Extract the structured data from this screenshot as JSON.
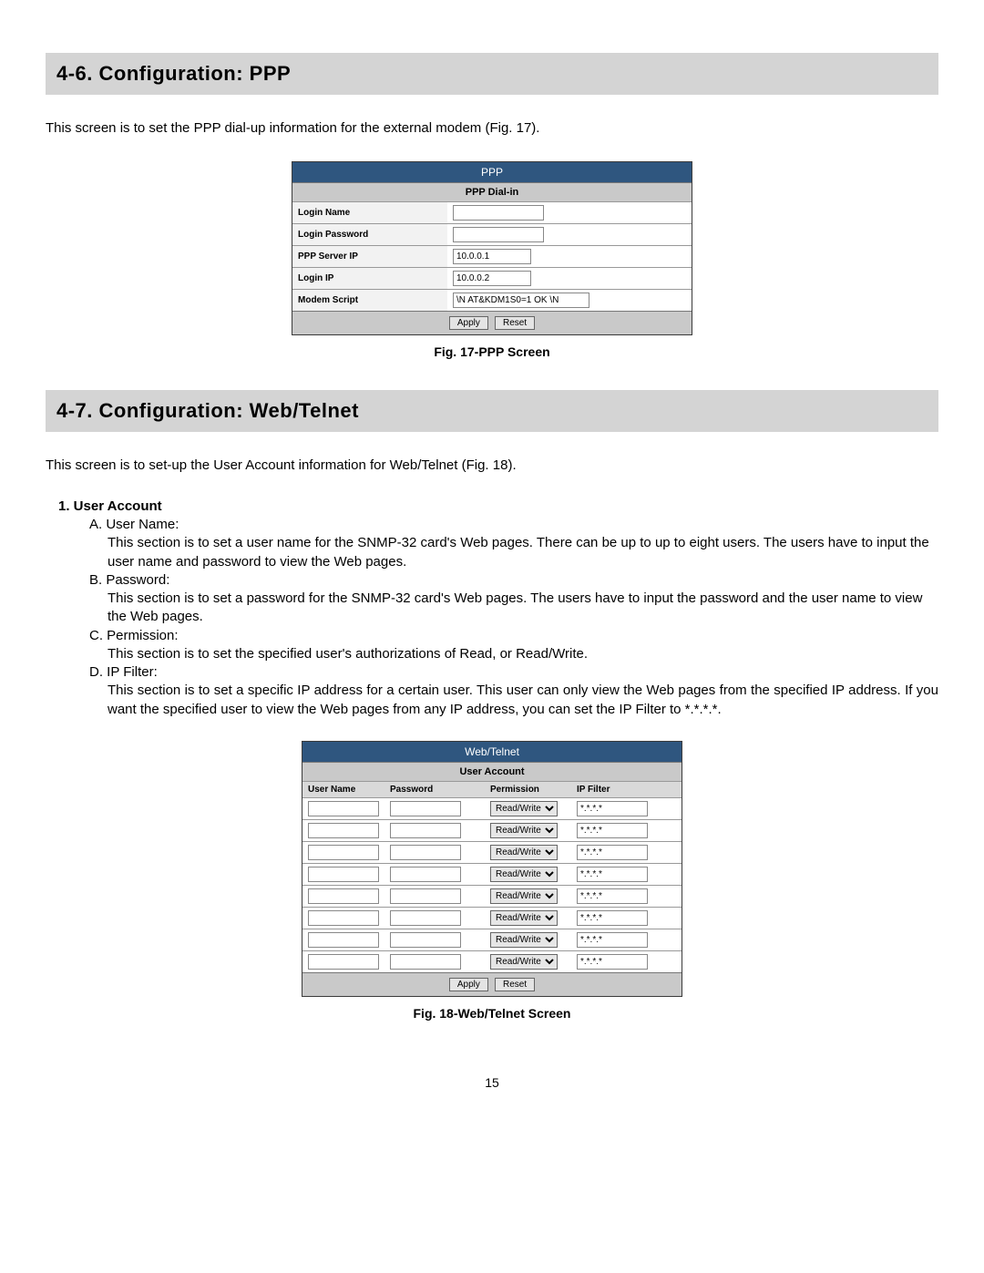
{
  "section1": {
    "heading": "4-6.  Configuration: PPP",
    "intro": "This screen is to set the PPP dial-up information for the external modem (Fig. 17)."
  },
  "ppp": {
    "title": "PPP",
    "subtitle": "PPP Dial-in",
    "row_login_name_label": "Login Name",
    "row_login_name_value": "",
    "row_login_password_label": "Login Password",
    "row_login_password_value": "",
    "row_server_ip_label": "PPP Server IP",
    "row_server_ip_value": "10.0.0.1",
    "row_login_ip_label": "Login IP",
    "row_login_ip_value": "10.0.0.2",
    "row_modem_script_label": "Modem Script",
    "row_modem_script_value": "\\N AT&KDM1S0=1 OK \\N",
    "apply_label": "Apply",
    "reset_label": "Reset",
    "caption": "Fig. 17-PPP Screen"
  },
  "section2": {
    "heading": "4-7.  Configuration: Web/Telnet",
    "intro": "This screen is to set-up the User Account information for Web/Telnet (Fig. 18)."
  },
  "ua": {
    "heading": "1.   User Account",
    "a_label": "A.   User Name:",
    "a_desc": "This section is to set a user name for the SNMP-32 card's Web pages.  There can be up to up to eight users.  The users have to input the user name and password to view the Web pages.",
    "b_label": "B.   Password:",
    "b_desc": "This section is to set a password for the SNMP-32 card's Web pages.  The users have to input the password and the user name to view the Web pages.",
    "c_label": "C.   Permission:",
    "c_desc": "This section is to set the specified user's authorizations of Read, or Read/Write.",
    "d_label": "D.   IP Filter:",
    "d_desc": "This section is to set a specific IP address for a certain user.  This user can only view the Web pages from the specified IP address.  If you want the specified user to view the Web pages from any IP address, you can set the IP Filter to *.*.*.*."
  },
  "wt": {
    "title": "Web/Telnet",
    "subtitle": "User Account",
    "col_user": "User Name",
    "col_pass": "Password",
    "col_perm": "Permission",
    "col_ipf": "IP Filter",
    "perm_option": "Read/Write",
    "ipf_value": "*.*.*.*",
    "apply_label": "Apply",
    "reset_label": "Reset",
    "caption": "Fig. 18-Web/Telnet Screen"
  },
  "page_number": "15"
}
